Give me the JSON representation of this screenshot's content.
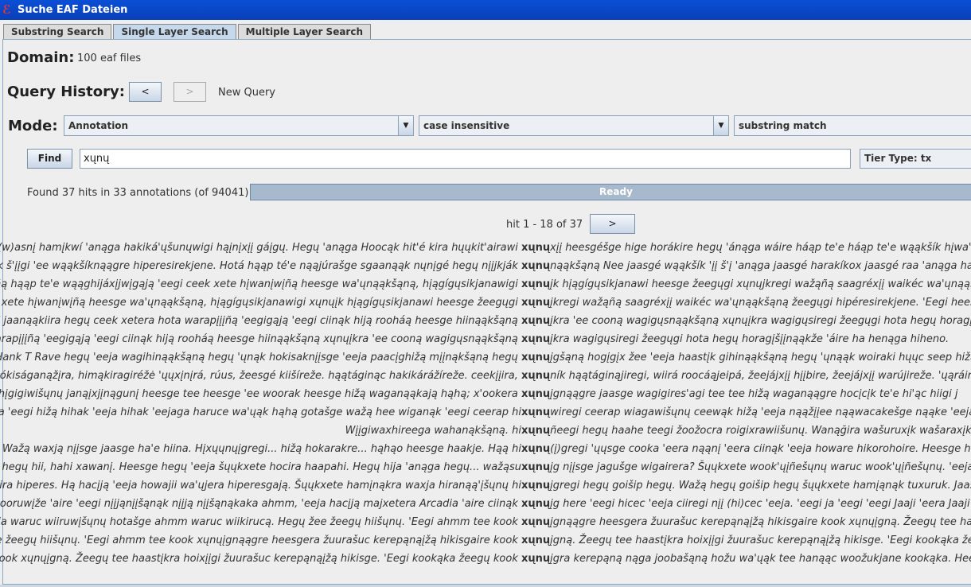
{
  "window": {
    "title": "Suche EAF Dateien",
    "icon": "app-logo-icon"
  },
  "tabs": [
    {
      "label": "Substring Search",
      "active": false
    },
    {
      "label": "Single Layer Search",
      "active": true
    },
    {
      "label": "Multiple Layer Search",
      "active": false
    }
  ],
  "domain": {
    "label": "Domain:",
    "value": "100 eaf files"
  },
  "history": {
    "label": "Query History:",
    "back": "<",
    "forward": ">",
    "status": "New Query"
  },
  "mode": {
    "label": "Mode:",
    "type_value": "Annotation",
    "case_value": "case insensitive",
    "match_value": "substring match"
  },
  "find": {
    "button": "Find",
    "query": "xųnų",
    "tier_type": "Tier Type: tx"
  },
  "status": {
    "found_text": "Found 37 hits in 33 annotations (of 94041)",
    "progress_label": "Ready",
    "progress": 1.0
  },
  "paging": {
    "range_text": "hit 1 - 18 of 37",
    "next": ">"
  },
  "results": [
    {
      "left": "oká(w)asnį hamįkwí 'anąga hakiká'ųšunųwigi hąįnįxįį gáįgų.  Hegų 'anąga Hoocąk hit'é kira hųųkit'airawi ",
      "hit": "xųnų",
      "right": "xįį heesgéšge hige horákire hegų 'ánąga wáire háąp te'e háąp te'e wąąkšík hįwa'ų h"
    },
    {
      "left": "kšík š'įįgi 'ee wąąkšíknąągre hiperesirekjene.  Hotá hąąp té'e nąąjúrašge sgaanąąk nųnįgé hegų nįįjkják ",
      "hit": "xųnų",
      "right": "nąąkšąną  Nee jaasgé wąąkšík 'įį š'į 'anąga jaasgé harakíkox jaasgé raa 'anąga han"
    },
    {
      "left": "gųñą hąąp te'e wąąghijáxįjwįgąją 'eegi ceek xete hįwanįwįñą heesge wa'ųnąąkšąną, hįągígųsikjanawigi ",
      "hit": "xųnų",
      "right": "įk hįągígųsikjanawi heesge žeegųgi xųnųjkregi wažąñą saagréxįį waikéc wa'ųnąąkšą"
    },
    {
      "left": "eek xete hįwanįwįñą heesge wa'ųnąąkšąną, hįągígųsikjanawigi xųnųįk hįągígųsikjanawi heesge žeegųgi ",
      "hit": "xųnų",
      "right": "įkregi wažąñą saagréxįį waikéc wa'ųnąąkšąną žeegųgi hipéresirekjene.  'Eegi heesg"
    },
    {
      "left": "ą 'eegi jaanąąkiira hegų ceek xetera hota warapįįįñą 'eegigąją 'eegi ciinąk hiją rooháą heesge hiinąąkšąną ",
      "hit": "xųnų",
      "right": "įkra 'ee cooną wagigųsnąąkšąną xųnųįkra wagigųsiregi žeegųgi hota hegų horagįšįį"
    },
    {
      "left": "ta warapįįįñą 'eegigąją 'eegi ciinąk hiją rooháą heesge hiinąąkšąną xųnųįkra 'ee cooną wagigųsnąąkšąną ",
      "hit": "xųnų",
      "right": "įkra wagigųsiregi žeegųgi hota hegų horagįšįįnąąkže 'áire ha henąga hiheno."
    },
    {
      "left": "Hank T Rave hegų 'eeja wagihinąąkšąną  hegų 'ųnąk hokisaknįįsge 'eeja paacįghižą mįįnąkšąną  hegų ",
      "hit": "xųnų",
      "right": "įgšąną  hogįgįx žee 'eeja haastįk gihinąąkšąną  hegų 'ųnąąk woiraki hųųc seep hižą"
    },
    {
      "left": "ciókiságanąžįra, himąkiragiréžė 'ųųxįnįrá, rúus, žeesgé kiišíreže.  hąątáginąc hakikárážíreže.  ceekįįira, ",
      "hit": "xųnų",
      "right": "ník hąątáginąjiregi, wiirá roocáąjeipá, žeejájxįį hįįbire, žeejájxįį warújireže.  'ųąráiregi,"
    },
    {
      "left": "e hįgigiwišųnų  janąįxjįnągunį heesge tee heesge 'ee woorak heesge hižą waganąąkają  hąhą; x'ookera ",
      "hit": "xųnų",
      "right": "įgnąągre jaasge wagigires'agi tee tee hižą waganąągre  hocįcįk te'e hi'ąc hiigi j"
    },
    {
      "left": "ja 'eegi hižą hihak 'eeja  hihak 'eejaga haruce wa'ųąk  hąhą  gotašge wažą hee wiganąk 'eegi ceerap hi",
      "hit": "xųnų",
      "right": "wiregi ceerap wiagawišųnų  ceewąk hižą 'eeja nąąžįįee nąąwacakešge nąąke 'eeja c"
    },
    {
      "left": "                                              Wįįgiwaxhireega wahanąkšąną.  hi",
      "hit": "xųnų",
      "right": "ñeegi hegų haahe teegi žoožocra roigixrawiišunų.  Wanąğira wašuruxįk wašaraxįk w"
    },
    {
      "left": "  Wažą waxją nįįsge jaasge ha'e hiina.  Hįxųųnųįgregi... hižą hokarakre... hąhąo heesge haakje.  Hąą hi",
      "hit": "xųnų",
      "right": "(į)gregi 'ųųsge cooka 'eera nąąnį 'eera ciinąk 'eeja howare hikorohoire.  Heesge heg"
    },
    {
      "left": "hegų hii, hahi xawanį.  Heesge hegų 'eeja šųųkxete hocira haapahi.  Hegų  hija 'anąga hegų... wažąsu",
      "hit": "xųnų",
      "right": "įg nįįsge jagušge wigairera?  Šųųkxete wook'ųįñešųnų waruc wook'ųįñešųnų.  'eeja"
    },
    {
      "left": "ciira hiperes.  Hą hacįją 'eeja howajii wa'ųjera hiperesgają.  Šųųkxete hamįnąkra waxja hiranąą'įšųnų hi",
      "hit": "xųnų",
      "right": "įgregi hegų goišip hegų.  Wažą hegų goišip hegų šųųkxete hamįąnąk tuxuruk.  Jaasg"
    },
    {
      "left": "wooruwįže 'aire 'eegi nįįjąnįįšąnąk nįįją nįįšąnąkaka  ahmm, 'eeja hacįją majxetera Arcadia 'aire ciinąk ",
      "hit": "xųnų",
      "right": "įg here 'eegi hicec 'eeja ciiregi nįį (hi)cec 'eeja.  'eegi ja 'eegi 'eegi Jaaji 'eera Jaaji 'e"
    },
    {
      "left": "Eeja waruc wiiruwįšųnų hotašge ahmm waruc wiikirucą.  Hegų žee žeegų hiišųnų.  'Eegi ahmm tee kook ",
      "hit": "xųnų",
      "right": "įgnąągre heesgera žuurašuc kerepąnąįžą hikisgaire kook xųnųįgną.  Žeegų tee haa"
    },
    {
      "left": "ee žeegų hiišųnų.  'Eegi ahmm tee kook xųnųįgnąągre heesgera žuurašuc kerepąnąįžą hikisgaire kook ",
      "hit": "xųnų",
      "right": "įgną.  Žeegų tee haastįkra hoixįįgi žuurašuc kerepąnąįžą hikisge.  'Eegi kookąka žee"
    },
    {
      "left": "kook xųnųįgną.  Žeegų tee haastįkra hoixįįgi žuurašuc kerepąnąįžą hikisge.  'Eegi kookąka žeegų kook ",
      "hit": "xųnų",
      "right": "įgra kerepąną nąga joobašąną hožu wa'ųąk tee hanąąc woožukjane kookąka.  Hees"
    }
  ]
}
